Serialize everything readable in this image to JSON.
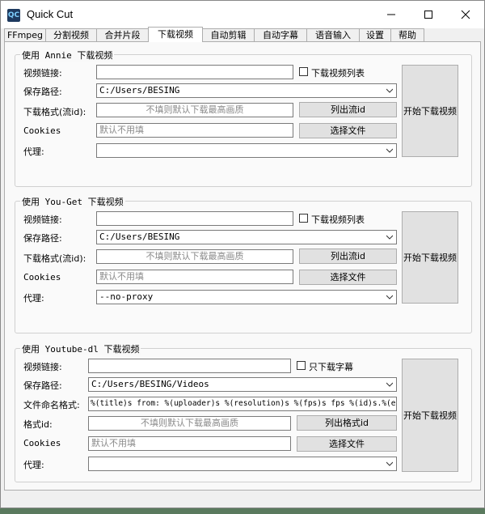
{
  "window": {
    "title": "Quick Cut",
    "app_icon": "QC"
  },
  "tabs": [
    "FFmpeg",
    "分割视频",
    "合并片段",
    "下载视频",
    "自动剪辑",
    "自动字幕",
    "语音输入",
    "设置",
    "帮助"
  ],
  "active_tab": "下载视频",
  "annie": {
    "group_title": "使用 Annie 下载视频",
    "url_label": "视频链接:",
    "url_value": "",
    "playlist_label": "下载视频列表",
    "save_label": "保存路径:",
    "save_value": "C:/Users/BESING",
    "format_label": "下载格式(流id):",
    "format_placeholder": "不填则默认下载最高画质",
    "list_button": "列出流id",
    "cookies_label": "Cookies",
    "cookies_placeholder": "默认不用填",
    "choose_file_button": "选择文件",
    "proxy_label": "代理:",
    "proxy_value": "",
    "start_button": "开始下载视频"
  },
  "youget": {
    "group_title": "使用 You-Get 下载视频",
    "url_label": "视频链接:",
    "url_value": "",
    "playlist_label": "下载视频列表",
    "save_label": "保存路径:",
    "save_value": "C:/Users/BESING",
    "format_label": "下载格式(流id):",
    "format_placeholder": "不填则默认下载最高画质",
    "list_button": "列出流id",
    "cookies_label": "Cookies",
    "cookies_placeholder": "默认不用填",
    "choose_file_button": "选择文件",
    "proxy_label": "代理:",
    "proxy_value": "--no-proxy",
    "start_button": "开始下载视频"
  },
  "youtubedl": {
    "group_title": "使用 Youtube-dl 下载视频",
    "url_label": "视频链接:",
    "url_value": "",
    "subtitle_only_label": "只下载字幕",
    "save_label": "保存路径:",
    "save_value": "C:/Users/BESING/Videos",
    "filename_label": "文件命名格式:",
    "filename_value": "%(title)s from: %(uploader)s %(resolution)s %(fps)s fps %(id)s.%(ext)s",
    "format_label": "格式id:",
    "format_placeholder": "不填则默认下载最高画质",
    "list_button": "列出格式id",
    "cookies_label": "Cookies",
    "cookies_placeholder": "默认不用填",
    "choose_file_button": "选择文件",
    "proxy_label": "代理:",
    "proxy_value": "",
    "start_button": "开始下载视频"
  }
}
